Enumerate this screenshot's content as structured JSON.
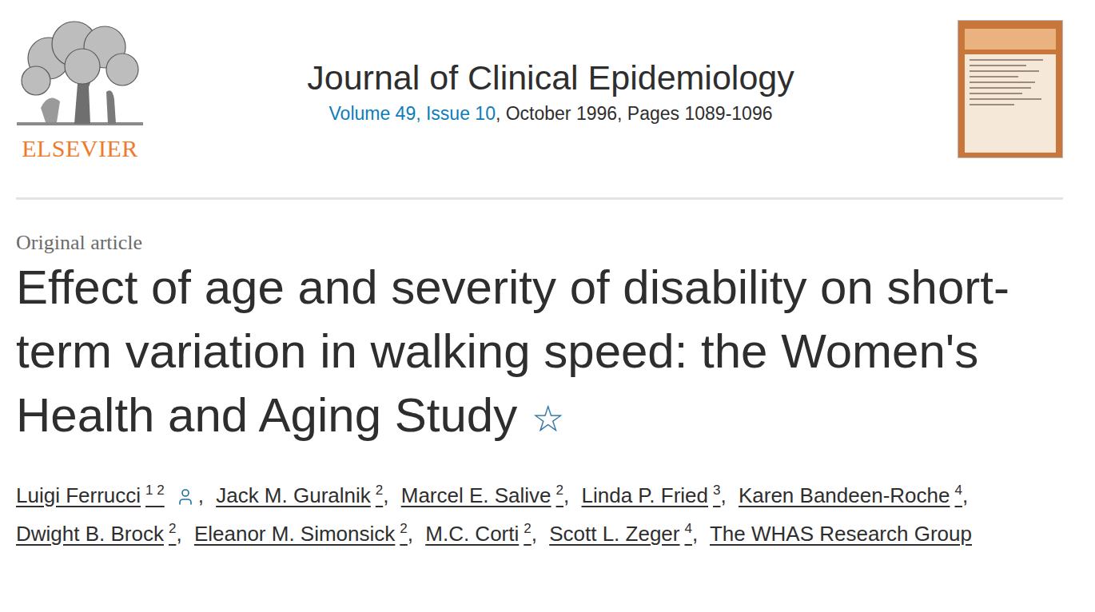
{
  "publisher": {
    "name": "ELSEVIER"
  },
  "journal": {
    "title": "Journal of Clinical Epidemiology",
    "issue_link": "Volume 49, Issue 10",
    "issue_details": ", October 1996, Pages 1089-1096"
  },
  "article": {
    "type": "Original article",
    "title": "Effect of age and severity of disability on short-term variation in walking speed: the Women's Health and Aging Study",
    "title_note": "☆"
  },
  "authors": [
    {
      "name": "Luigi Ferrucci",
      "affiliations": [
        "1",
        "2"
      ],
      "corresponding": true,
      "suffix": ","
    },
    {
      "name": "Jack M. Guralnik",
      "affiliations": [
        "2"
      ],
      "corresponding": false,
      "suffix": ","
    },
    {
      "name": "Marcel E. Salive",
      "affiliations": [
        "2"
      ],
      "corresponding": false,
      "suffix": ","
    },
    {
      "name": "Linda P. Fried",
      "affiliations": [
        "3"
      ],
      "corresponding": false,
      "suffix": ","
    },
    {
      "name": "Karen Bandeen-Roche",
      "affiliations": [
        "4"
      ],
      "corresponding": false,
      "suffix": ","
    },
    {
      "name": "Dwight B. Brock",
      "affiliations": [
        "2"
      ],
      "corresponding": false,
      "suffix": ","
    },
    {
      "name": "Eleanor M. Simonsick",
      "affiliations": [
        "2"
      ],
      "corresponding": false,
      "suffix": ","
    },
    {
      "name": "M.C. Corti",
      "affiliations": [
        "2"
      ],
      "corresponding": false,
      "suffix": ","
    },
    {
      "name": "Scott L. Zeger",
      "affiliations": [
        "4"
      ],
      "corresponding": false,
      "suffix": ","
    },
    {
      "name": "The WHAS Research Group",
      "affiliations": [],
      "corresponding": false,
      "suffix": ""
    }
  ]
}
